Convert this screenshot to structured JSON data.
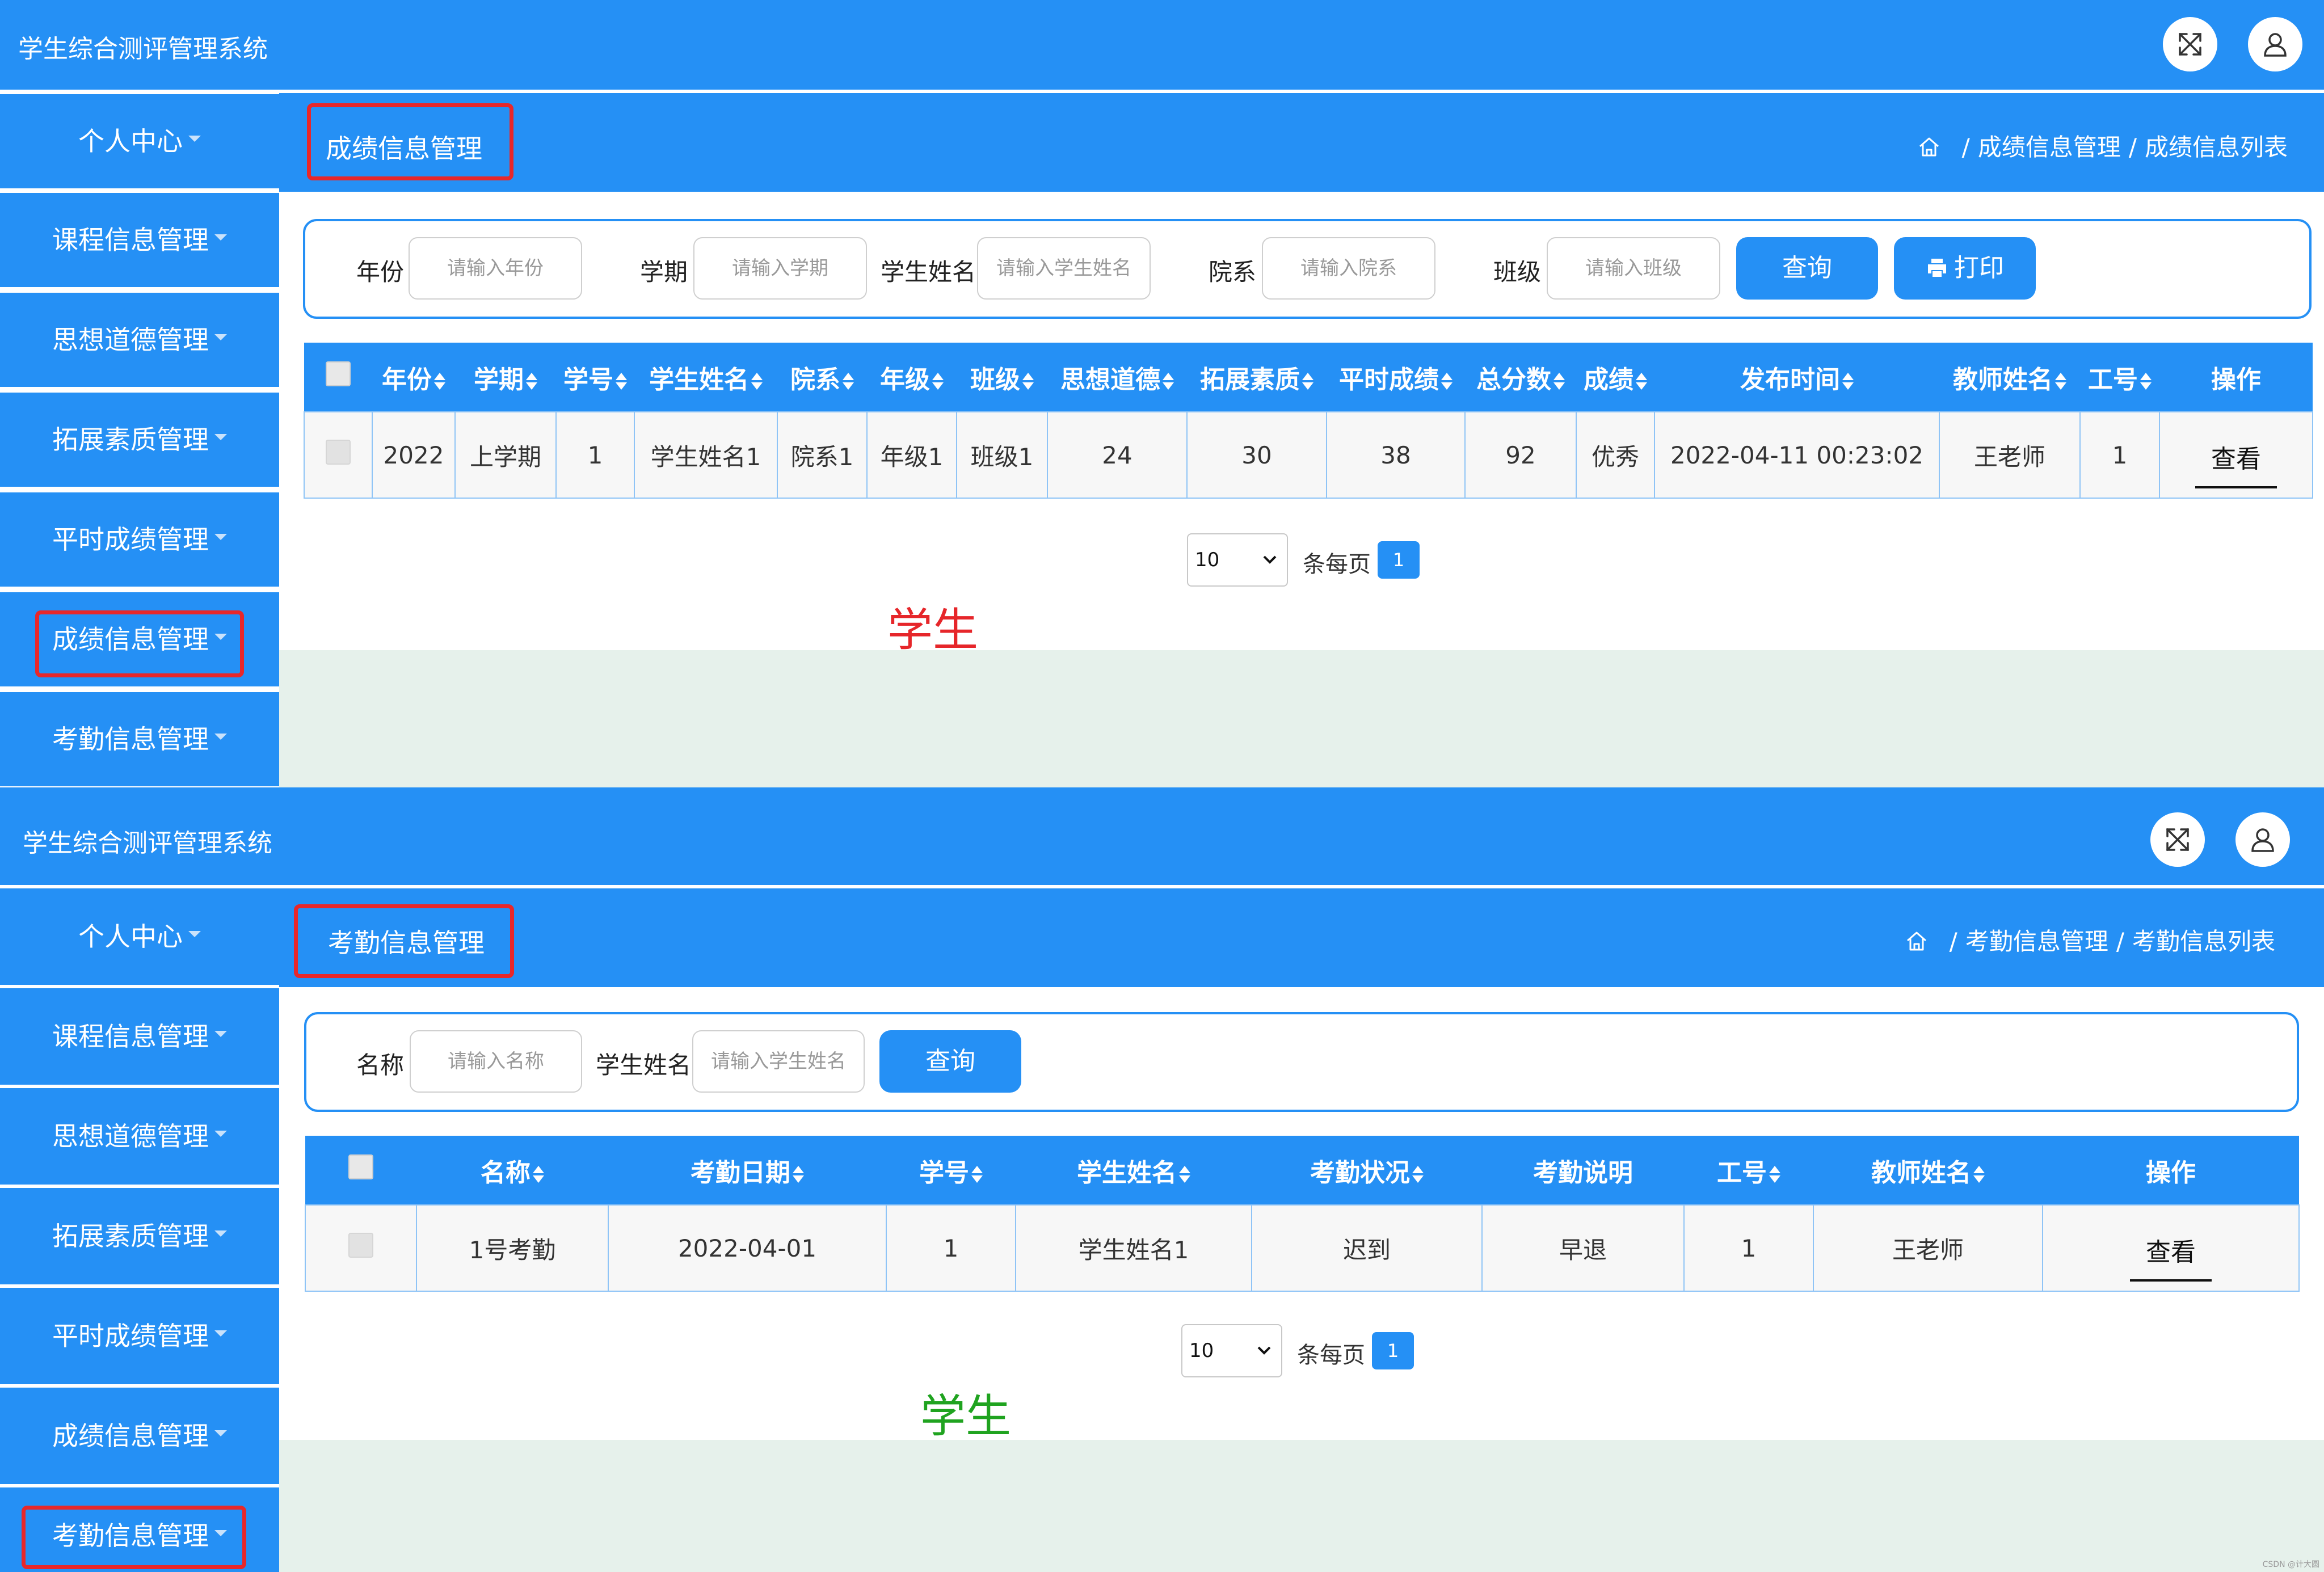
{
  "app_title": "学生综合测评管理系统",
  "icons": {
    "fullscreen": "fullscreen-icon",
    "user": "user-icon",
    "home": "home-icon",
    "print": "printer-icon",
    "caret": "caret-down-icon",
    "sort": "sort-icon"
  },
  "colors": {
    "primary": "#2590f5",
    "highlight_box": "#e8272a",
    "role_label_top": "#e6262a",
    "role_label_bottom": "#1fa31f",
    "content_bg": "#e6f1eb"
  },
  "sidebar": {
    "items": [
      "个人中心",
      "课程信息管理",
      "思想道德管理",
      "拓展素质管理",
      "平时成绩管理",
      "成绩信息管理",
      "考勤信息管理"
    ]
  },
  "grades": {
    "header_title": "成绩信息管理",
    "breadcrumb": [
      "成绩信息管理",
      "成绩信息列表"
    ],
    "search": {
      "fields": [
        {
          "label": "年份",
          "placeholder": "请输入年份"
        },
        {
          "label": "学期",
          "placeholder": "请输入学期"
        },
        {
          "label": "学生姓名",
          "placeholder": "请输入学生姓名"
        },
        {
          "label": "院系",
          "placeholder": "请输入院系"
        },
        {
          "label": "班级",
          "placeholder": "请输入班级"
        }
      ],
      "query_label": "查询",
      "print_label": "打印"
    },
    "columns": [
      "年份",
      "学期",
      "学号",
      "学生姓名",
      "院系",
      "年级",
      "班级",
      "思想道德",
      "拓展素质",
      "平时成绩",
      "总分数",
      "成绩",
      "发布时间",
      "教师姓名",
      "工号",
      "操作"
    ],
    "rows": [
      [
        "2022",
        "上学期",
        "1",
        "学生姓名1",
        "院系1",
        "年级1",
        "班级1",
        "24",
        "30",
        "38",
        "92",
        "优秀",
        "2022-04-11 00:23:02",
        "王老师",
        "1"
      ]
    ],
    "action_label": "查看",
    "pager": {
      "page_size": "10",
      "per_page_label": "条每页",
      "current_page": "1"
    },
    "role_label": "学生"
  },
  "attendance": {
    "header_title": "考勤信息管理",
    "breadcrumb": [
      "考勤信息管理",
      "考勤信息列表"
    ],
    "search": {
      "fields": [
        {
          "label": "名称",
          "placeholder": "请输入名称"
        },
        {
          "label": "学生姓名",
          "placeholder": "请输入学生姓名"
        }
      ],
      "query_label": "查询"
    },
    "columns": [
      "名称",
      "考勤日期",
      "学号",
      "学生姓名",
      "考勤状况",
      "考勤说明",
      "工号",
      "教师姓名",
      "操作"
    ],
    "rows": [
      [
        "1号考勤",
        "2022-04-01",
        "1",
        "学生姓名1",
        "迟到",
        "早退",
        "1",
        "王老师"
      ]
    ],
    "action_label": "查看",
    "pager": {
      "page_size": "10",
      "per_page_label": "条每页",
      "current_page": "1"
    },
    "role_label": "学生"
  },
  "watermark": "CSDN @计大圆"
}
